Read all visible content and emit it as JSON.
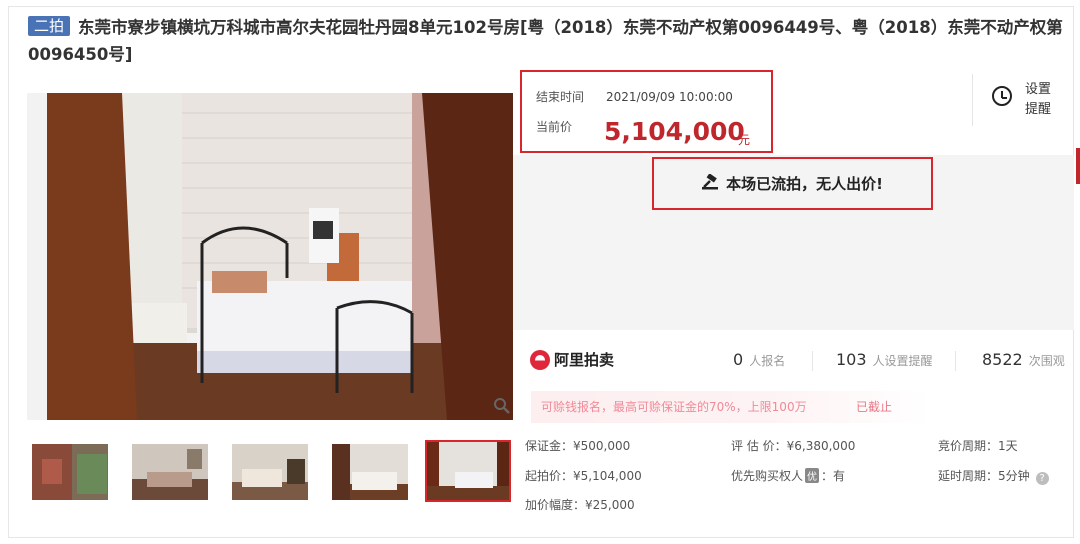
{
  "title": {
    "badge": "二拍",
    "text": "东莞市寮步镇横坑万科城市高尔夫花园牡丹园8单元102号房[粤（2018）东莞不动产权第0096449号、粤（2018）东莞不动产权第0096450号]"
  },
  "auction": {
    "end_time_label": "结束时间",
    "end_time_value": "2021/09/09 10:00:00",
    "current_price_label": "当前价",
    "current_price_value": "5,104,000",
    "current_price_unit": "元",
    "status": "本场已流拍，无人出价!",
    "remind_label": "设置提醒"
  },
  "stats": {
    "logo_text": "阿里拍卖",
    "signup_count": "0",
    "signup_label": "人报名",
    "reminder_count": "103",
    "reminder_label": "人设置提醒",
    "views_count": "8522",
    "views_label": "次围观"
  },
  "notice": {
    "text": "可赊钱报名，最高可赊保证金的70%，上限100万",
    "status": "已截止"
  },
  "info": {
    "deposit": "保证金：¥500,000",
    "start_price": "起拍价：¥5,104,000",
    "increment": "加价幅度：¥25,000",
    "appraisal": "评 估 价：¥6,380,000",
    "priority_prefix": "优先购买权人",
    "priority_badge": "优",
    "priority_value": "：有",
    "bid_period": "竞价周期：1天",
    "extend_period": "延时周期：5分钟",
    "help_icon_glyph": "?"
  },
  "colors": {
    "accent_red": "#d9262c",
    "price_red": "#c0272d",
    "badge_blue": "#4a73b6"
  },
  "icons": {
    "zoom": "magnifier-icon",
    "gavel": "gavel-icon",
    "remind": "alarm-clock-icon"
  }
}
